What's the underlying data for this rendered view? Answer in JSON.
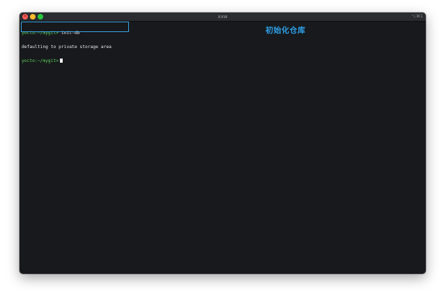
{
  "window": {
    "title": "xxw",
    "shortcut": "⌥⌘1",
    "close_glyph": "×"
  },
  "terminal": {
    "lines": [
      {
        "prompt": "yocto:~/mygit>",
        "text": " init-db"
      },
      {
        "prompt": "",
        "text": "defaulting to private storage area"
      },
      {
        "prompt": "yocto:~/mygit>",
        "text": " "
      }
    ]
  },
  "annotation": {
    "text": "初始化仓库"
  },
  "colors": {
    "terminal_bg": "#17191c",
    "prompt": "#5fd35f",
    "text": "#e8e8e8",
    "annotation": "#2f9fe6",
    "highlight_border": "#3aa8e8"
  }
}
